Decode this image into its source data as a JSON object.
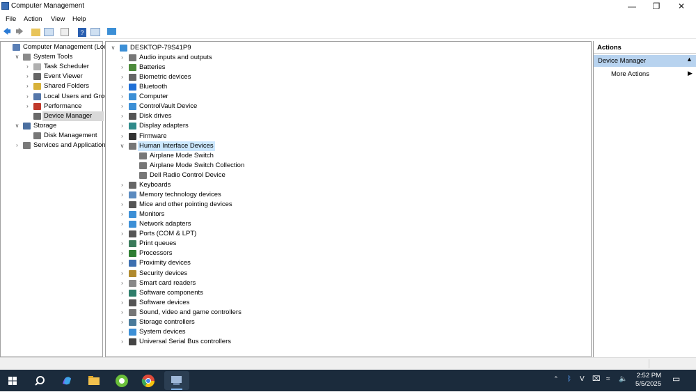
{
  "window": {
    "title": "Computer Management"
  },
  "menu": [
    "File",
    "Action",
    "View",
    "Help"
  ],
  "left_tree": [
    {
      "label": "Computer Management (Local)",
      "chev": "",
      "icon": "computer-management-icon",
      "color": "#5b7fb5"
    },
    {
      "label": "System Tools",
      "chev": "v",
      "icon": "tools-icon",
      "color": "#8a8a8a"
    },
    {
      "label": "Task Scheduler",
      "chev": ">",
      "icon": "clock-icon",
      "color": "#b0b0b0"
    },
    {
      "label": "Event Viewer",
      "chev": ">",
      "icon": "event-viewer-icon",
      "color": "#666666"
    },
    {
      "label": "Shared Folders",
      "chev": ">",
      "icon": "shared-folder-icon",
      "color": "#d8b23a"
    },
    {
      "label": "Local Users and Groups",
      "chev": ">",
      "icon": "users-icon",
      "color": "#5577aa"
    },
    {
      "label": "Performance",
      "chev": ">",
      "icon": "performance-icon",
      "color": "#c0392b"
    },
    {
      "label": "Device Manager",
      "chev": "",
      "icon": "device-manager-icon",
      "color": "#6a6a6a"
    },
    {
      "label": "Storage",
      "chev": "v",
      "icon": "storage-icon",
      "color": "#4a6fa0"
    },
    {
      "label": "Disk Management",
      "chev": "",
      "icon": "disk-management-icon",
      "color": "#777777"
    },
    {
      "label": "Services and Applications",
      "chev": ">",
      "icon": "services-icon",
      "color": "#7a7a7a"
    }
  ],
  "device_root": "DESKTOP-79S41P9",
  "devices": [
    {
      "label": "Audio inputs and outputs",
      "chev": ">",
      "icon": "speaker-icon",
      "color": "#777777"
    },
    {
      "label": "Batteries",
      "chev": ">",
      "icon": "battery-icon",
      "color": "#4c8a3a"
    },
    {
      "label": "Biometric devices",
      "chev": ">",
      "icon": "fingerprint-icon",
      "color": "#666666"
    },
    {
      "label": "Bluetooth",
      "chev": ">",
      "icon": "bluetooth-icon",
      "color": "#1f6fd6"
    },
    {
      "label": "Computer",
      "chev": ">",
      "icon": "monitor-icon",
      "color": "#3c8fd6"
    },
    {
      "label": "ControlVault Device",
      "chev": ">",
      "icon": "controlvault-icon",
      "color": "#3c8fd6"
    },
    {
      "label": "Disk drives",
      "chev": ">",
      "icon": "disk-icon",
      "color": "#555555"
    },
    {
      "label": "Display adapters",
      "chev": ">",
      "icon": "display-adapter-icon",
      "color": "#2f8a8a"
    },
    {
      "label": "Firmware",
      "chev": ">",
      "icon": "firmware-icon",
      "color": "#333333"
    },
    {
      "label": "Human Interface Devices",
      "chev": "v",
      "icon": "hid-icon",
      "color": "#777777",
      "selected": true
    },
    {
      "label": "Airplane Mode Switch",
      "chev": "",
      "icon": "hid-icon",
      "color": "#777777",
      "child": true
    },
    {
      "label": "Airplane Mode Switch Collection",
      "chev": "",
      "icon": "hid-icon",
      "color": "#777777",
      "child": true
    },
    {
      "label": "Dell Radio Control Device",
      "chev": "",
      "icon": "hid-icon",
      "color": "#777777",
      "child": true
    },
    {
      "label": "Keyboards",
      "chev": ">",
      "icon": "keyboard-icon",
      "color": "#666666"
    },
    {
      "label": "Memory technology devices",
      "chev": ">",
      "icon": "memory-icon",
      "color": "#5a8abf"
    },
    {
      "label": "Mice and other pointing devices",
      "chev": ">",
      "icon": "mouse-icon",
      "color": "#555555"
    },
    {
      "label": "Monitors",
      "chev": ">",
      "icon": "monitor-icon",
      "color": "#3c8fd6"
    },
    {
      "label": "Network adapters",
      "chev": ">",
      "icon": "network-icon",
      "color": "#3c8fd6"
    },
    {
      "label": "Ports (COM & LPT)",
      "chev": ">",
      "icon": "port-icon",
      "color": "#555555"
    },
    {
      "label": "Print queues",
      "chev": ">",
      "icon": "printer-icon",
      "color": "#3a7a5a"
    },
    {
      "label": "Processors",
      "chev": ">",
      "icon": "processor-icon",
      "color": "#2e7d32"
    },
    {
      "label": "Proximity devices",
      "chev": ">",
      "icon": "proximity-icon",
      "color": "#3c6fb0"
    },
    {
      "label": "Security devices",
      "chev": ">",
      "icon": "security-icon",
      "color": "#b08a2e"
    },
    {
      "label": "Smart card readers",
      "chev": ">",
      "icon": "smartcard-icon",
      "color": "#888888"
    },
    {
      "label": "Software components",
      "chev": ">",
      "icon": "software-component-icon",
      "color": "#2e7d6a"
    },
    {
      "label": "Software devices",
      "chev": ">",
      "icon": "software-device-icon",
      "color": "#555555"
    },
    {
      "label": "Sound, video and game controllers",
      "chev": ">",
      "icon": "sound-icon",
      "color": "#777777"
    },
    {
      "label": "Storage controllers",
      "chev": ">",
      "icon": "storage-controller-icon",
      "color": "#4a7a9a"
    },
    {
      "label": "System devices",
      "chev": ">",
      "icon": "system-device-icon",
      "color": "#3c8fd6"
    },
    {
      "label": "Universal Serial Bus controllers",
      "chev": ">",
      "icon": "usb-icon",
      "color": "#444444"
    }
  ],
  "actions": {
    "header": "Actions",
    "section": "Device Manager",
    "items": [
      "More Actions"
    ]
  },
  "taskbar": {
    "time": "2:52 PM",
    "date": "5/5/2025",
    "apps": [
      {
        "name": "start-button",
        "color": "#ffffff"
      },
      {
        "name": "search-taskbar-button",
        "color": "#ffffff"
      },
      {
        "name": "copilot-taskbar-button",
        "color": "#7b5cf0"
      },
      {
        "name": "file-explorer-taskbar-button",
        "color": "#f2c14e"
      },
      {
        "name": "greenshot-taskbar-button",
        "color": "#6abf3a"
      },
      {
        "name": "chrome-taskbar-button",
        "color": "#e04a3a"
      },
      {
        "name": "computer-management-taskbar-button",
        "color": "#9fb8d8"
      }
    ]
  },
  "colors": {
    "accent": "#cce8ff",
    "actions_header": "#b8d3ef",
    "taskbar": "#1b2b3c"
  }
}
